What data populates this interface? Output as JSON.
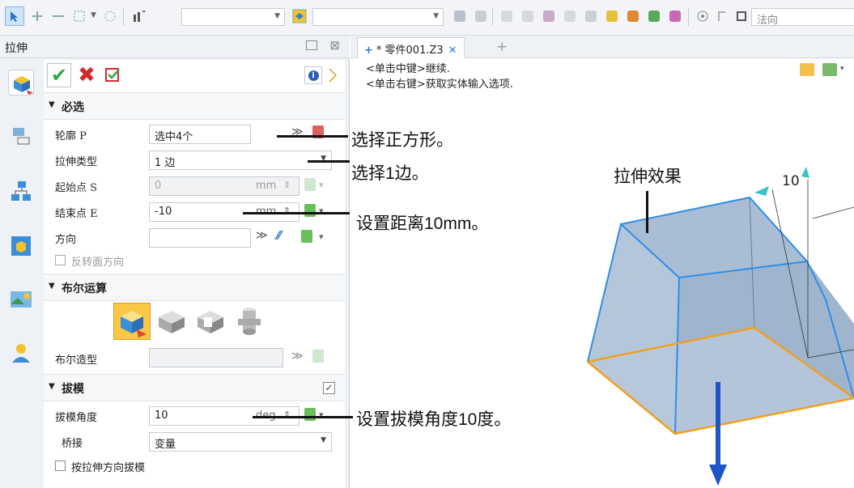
{
  "toolbar": {
    "right_combo_value": "法向"
  },
  "panel": {
    "title": "拉伸",
    "sections": {
      "required": "必选",
      "boolean": "布尔运算",
      "draft": "拔模"
    },
    "fields": {
      "profile": {
        "label": "轮廓 P",
        "value": "选中4个"
      },
      "extrude_type": {
        "label": "拉伸类型",
        "value": "1 边"
      },
      "start_point": {
        "label": "起始点 S",
        "value": "0",
        "unit": "mm"
      },
      "end_point": {
        "label": "结束点 E",
        "value": "-10",
        "unit": "mm"
      },
      "direction": {
        "label": "方向",
        "value": ""
      },
      "reverse_face": {
        "label": "反转面方向",
        "checked": false
      },
      "boolean_shape": {
        "label": "布尔造型",
        "value": ""
      },
      "draft_angle": {
        "label": "拔模角度",
        "value": "10",
        "unit": "deg"
      },
      "bridge": {
        "label": "桥接",
        "value": "变量"
      },
      "draft_by_direction": {
        "label": "按拉伸方向拔模",
        "checked": false
      }
    }
  },
  "tab": {
    "label": "* 零件001.Z3"
  },
  "hints": [
    "<单击中键>继续.",
    "<单击右键>获取实体输入选项."
  ],
  "annotations": {
    "select_square": "选择正方形。",
    "select_one_side": "选择1边。",
    "set_distance": "设置距离10mm。",
    "set_draft": "设置拔模角度10度。",
    "effect": "拉伸效果"
  },
  "viewport": {
    "dimension_value": "10"
  },
  "colors": {
    "accent": "#2e7bd6",
    "solid_fill": "#a9bdd4",
    "edge": "#2e8ee8",
    "base_edge": "#f0a020",
    "arrow": "#1f55c9"
  }
}
